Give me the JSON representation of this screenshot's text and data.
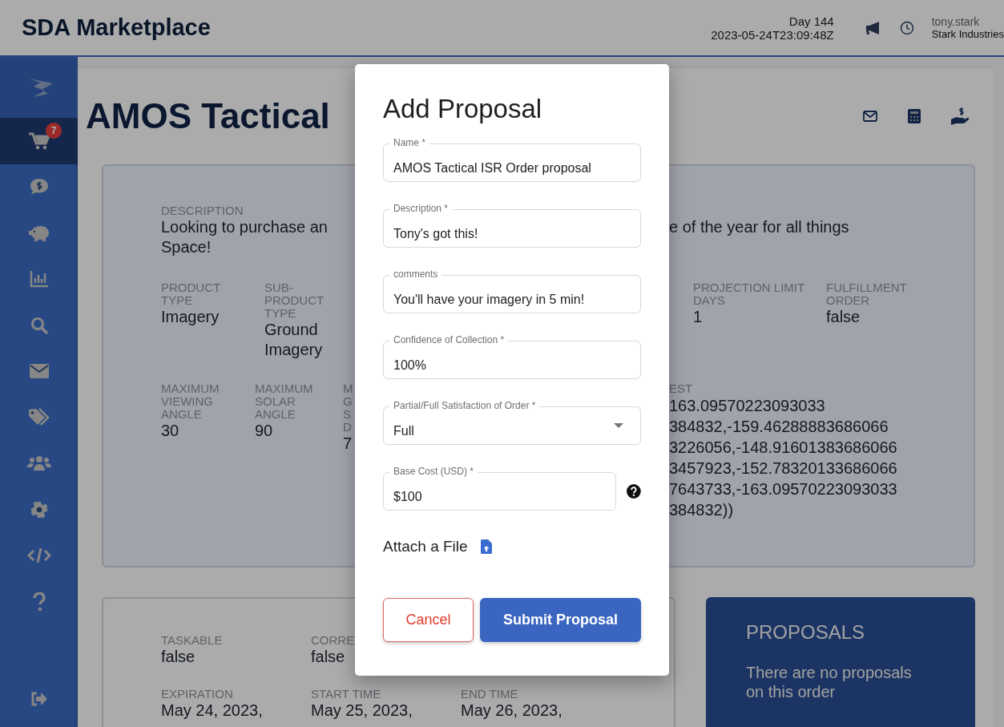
{
  "header": {
    "title": "SDA Marketplace",
    "day": "Day 144",
    "timestamp": "2023-05-24T23:09:48Z",
    "user": "tony.stark",
    "org": "Stark Industries"
  },
  "sidebar": {
    "items": [
      {
        "kind": "logo",
        "selected": false
      },
      {
        "kind": "cart",
        "selected": true,
        "badge": "7"
      },
      {
        "kind": "chat-dollar",
        "selected": false
      },
      {
        "kind": "piggy",
        "selected": false
      },
      {
        "kind": "chart",
        "selected": false
      },
      {
        "kind": "search",
        "selected": false
      },
      {
        "kind": "mail",
        "selected": false
      },
      {
        "kind": "tags",
        "selected": false
      },
      {
        "kind": "users",
        "selected": false
      },
      {
        "kind": "gear",
        "selected": false
      },
      {
        "kind": "code",
        "selected": false
      },
      {
        "kind": "help",
        "selected": false
      },
      {
        "kind": "logout",
        "selected": false
      }
    ]
  },
  "page": {
    "title": "AMOS Tactical",
    "actions": [
      {
        "kind": "mail"
      },
      {
        "kind": "calculator"
      },
      {
        "kind": "hand-dollar"
      }
    ]
  },
  "details": {
    "description_label": "DESCRIPTION",
    "description_left": [
      "Looking to purchase an",
      "Space!"
    ],
    "description_right": "e of the year for all things",
    "specs_left": [
      {
        "label": "PRODUCT TYPE",
        "value": "Imagery"
      },
      {
        "label": "SUB-PRODUCT TYPE",
        "value": "Ground Imagery"
      }
    ],
    "specs_right": [
      {
        "label": "PROJECTION LIMIT DAYS",
        "value": "1"
      },
      {
        "label": "FULFILLMENT ORDER",
        "value": "false"
      }
    ],
    "angles_left": [
      {
        "label": "MAXIMUM VIEWING ANGLE",
        "value": "30"
      },
      {
        "label": "MAXIMUM SOLAR ANGLE",
        "value": "90"
      },
      {
        "label": "M G S D",
        "value": "7"
      }
    ],
    "area_label": "EST",
    "area_lines": [
      "163.09570223093033",
      "384832,-159.46288883686066",
      "3226056,-148.91601383686066",
      "3457923,-152.78320133686066",
      "7643733,-163.09570223093033",
      "384832))"
    ]
  },
  "timing": {
    "rows": [
      [
        {
          "label": "TASKABLE",
          "value": "false"
        },
        {
          "label": "CORRE",
          "value": "false"
        }
      ],
      [
        {
          "label": "EXPIRATION",
          "value": "May 24, 2023,"
        },
        {
          "label": "START TIME",
          "value": "May 25, 2023,"
        },
        {
          "label": "END TIME",
          "value": "May 26, 2023,"
        }
      ]
    ]
  },
  "proposals": {
    "title": "PROPOSALS",
    "message": "There are no proposals on this order"
  },
  "dialog": {
    "title": "Add Proposal",
    "fields": [
      {
        "kind": "text",
        "label": "Name *",
        "value": "AMOS Tactical ISR Order proposal"
      },
      {
        "kind": "text",
        "label": "Description *",
        "value": "Tony's got this!"
      },
      {
        "kind": "text",
        "label": "comments",
        "value": "You'll have your imagery in 5 min!"
      },
      {
        "kind": "text",
        "label": "Confidence of Collection *",
        "value": "100%"
      },
      {
        "kind": "select",
        "label": "Partial/Full Satisfaction of Order *",
        "value": "Full"
      },
      {
        "kind": "help",
        "label": "Base Cost (USD) *",
        "value": "$100"
      }
    ],
    "attach_label": "Attach a File",
    "buttons": [
      {
        "kind": "secondary",
        "label": "Cancel"
      },
      {
        "kind": "primary",
        "label": "Submit Proposal"
      }
    ]
  }
}
